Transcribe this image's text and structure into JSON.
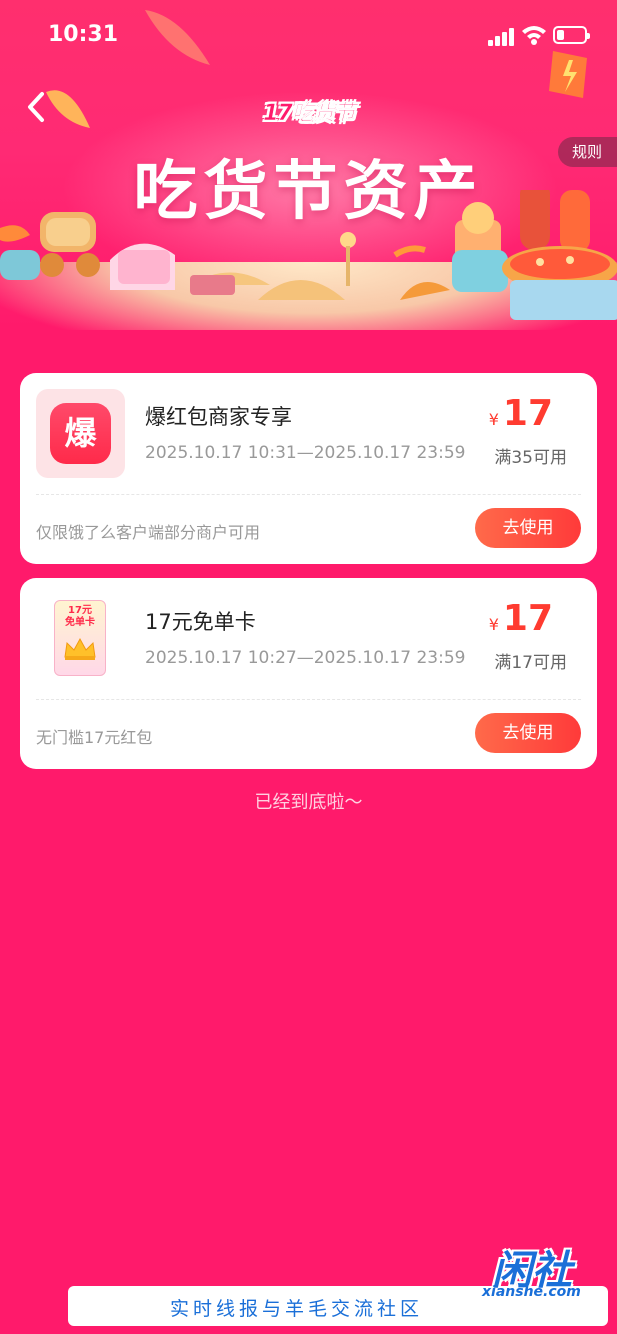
{
  "status_bar": {
    "time": "10:31"
  },
  "header": {
    "festival_logo": "17吃货节",
    "title": "吃货节资产",
    "rules_label": "规则"
  },
  "coupons": [
    {
      "title": "爆红包商家专享",
      "icon_char": "爆",
      "date_range": "2025.10.17 10:31—2025.10.17 23:59",
      "currency": "¥",
      "amount": "17",
      "condition": "满35可用",
      "note": "仅限饿了么客户端部分商户可用",
      "button": "去使用"
    },
    {
      "title": "17元免单卡",
      "icon_text": "17元\n免单卡",
      "date_range": "2025.10.17 10:27—2025.10.17 23:59",
      "currency": "¥",
      "amount": "17",
      "condition": "满17可用",
      "note": "无门槛17元红包",
      "button": "去使用"
    }
  ],
  "footer": {
    "end_tip": "已经到底啦～"
  },
  "watermark": {
    "logo_text": "闲社",
    "logo_domain": "xianshe.com",
    "slogan": "实时线报与羊毛交流社区"
  },
  "colors": {
    "background": "#ff1a6b",
    "price": "#ff3b30",
    "button": "#ff4a3a",
    "watermark": "#1a6fd8"
  }
}
